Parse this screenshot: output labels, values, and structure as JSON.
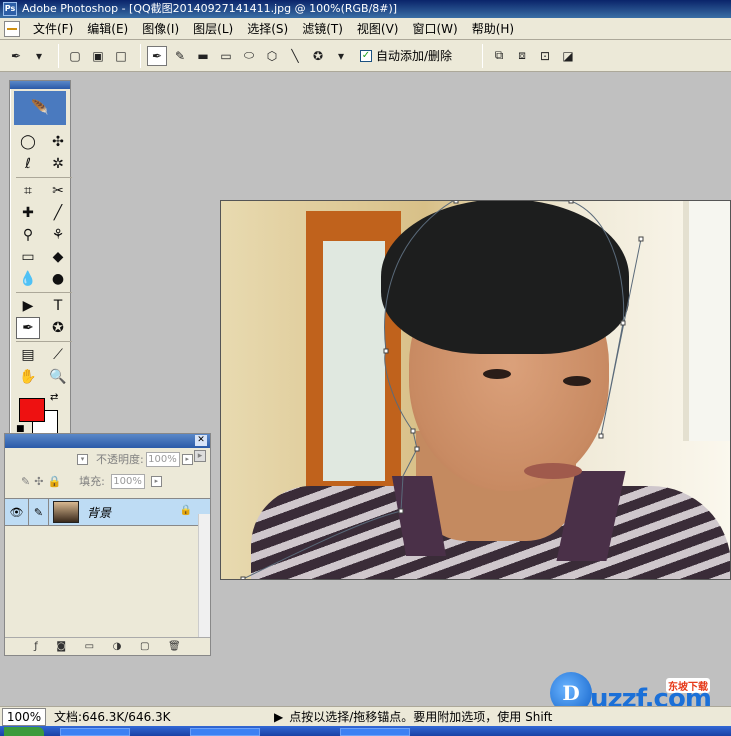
{
  "window": {
    "title": "Adobe Photoshop - [QQ截图20140927141411.jpg @ 100%(RGB/8#)]",
    "app_icon": "ps-icon"
  },
  "menu": {
    "items": [
      "文件(F)",
      "编辑(E)",
      "图像(I)",
      "图层(L)",
      "选择(S)",
      "滤镜(T)",
      "视图(V)",
      "窗口(W)",
      "帮助(H)"
    ]
  },
  "options": {
    "auto_add_delete_label": "自动添加/删除",
    "auto_add_delete_checked": true
  },
  "toolbox": {
    "tools": [
      "marquee-icon",
      "move-icon",
      "lasso-icon",
      "magic-wand-icon",
      "crop-icon",
      "slice-icon",
      "healing-icon",
      "brush-icon",
      "clone-stamp-icon",
      "history-brush-icon",
      "eraser-icon",
      "paint-bucket-icon",
      "blur-icon",
      "dodge-icon",
      "path-select-icon",
      "type-icon",
      "pen-icon",
      "custom-shape-icon",
      "notes-icon",
      "eyedropper-icon",
      "hand-icon",
      "zoom-icon"
    ],
    "tool_glyphs": [
      "◯",
      "✣",
      "ℓ",
      "✲",
      "⌗",
      "✂",
      "✚",
      "╱",
      "⚲",
      "⚘",
      "▭",
      "◆",
      "💧",
      "●",
      "▶",
      "T",
      "✒",
      "✪",
      "▤",
      "⟋",
      "✋",
      "🔍"
    ],
    "foreground_color": "#ee1111",
    "background_color": "#ffffff"
  },
  "layers": {
    "opacity_label": "不透明度:",
    "opacity_value": "100%",
    "fill_label": "填充:",
    "fill_value": "100%",
    "layer_name": "背景"
  },
  "status": {
    "zoom": "100%",
    "doc_size": "文档:646.3K/646.3K",
    "hint": "点按以选择/拖移锚点。要用附加选项，使用 Shift"
  },
  "watermark": {
    "logo_letter": "D",
    "brand": "uzzf.com",
    "tag": "东坡下载"
  }
}
